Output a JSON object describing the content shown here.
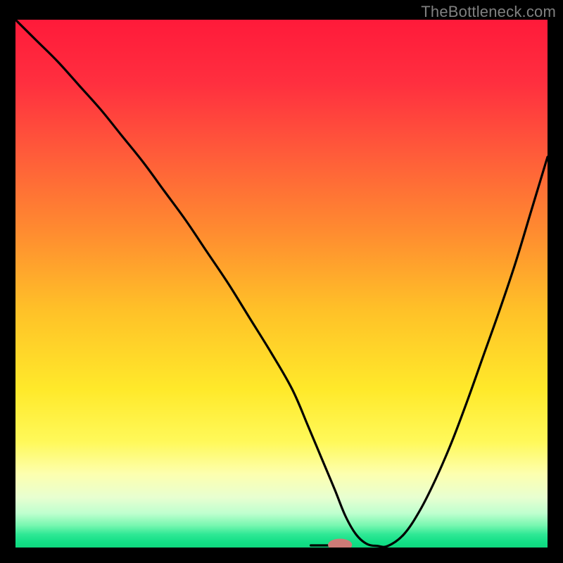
{
  "watermark": "TheBottleneck.com",
  "colors": {
    "frame": "#000000",
    "gradient_stops": [
      {
        "offset": 0.0,
        "color": "#ff1a3a"
      },
      {
        "offset": 0.12,
        "color": "#ff2f3f"
      },
      {
        "offset": 0.25,
        "color": "#ff5a3a"
      },
      {
        "offset": 0.4,
        "color": "#ff8b30"
      },
      {
        "offset": 0.55,
        "color": "#ffc128"
      },
      {
        "offset": 0.7,
        "color": "#ffe92a"
      },
      {
        "offset": 0.8,
        "color": "#fff95a"
      },
      {
        "offset": 0.86,
        "color": "#fdffae"
      },
      {
        "offset": 0.905,
        "color": "#e8ffd0"
      },
      {
        "offset": 0.935,
        "color": "#bfffcf"
      },
      {
        "offset": 0.958,
        "color": "#78f7b0"
      },
      {
        "offset": 0.975,
        "color": "#2fe895"
      },
      {
        "offset": 0.99,
        "color": "#12df86"
      },
      {
        "offset": 1.0,
        "color": "#0fd87f"
      }
    ],
    "curve": "#000000",
    "marker_fill": "#cd7b77",
    "marker_stroke": "#cd7b77"
  },
  "chart_data": {
    "type": "line",
    "title": "",
    "xlabel": "",
    "ylabel": "",
    "xlim": [
      0,
      100
    ],
    "ylim": [
      0,
      100
    ],
    "grid": false,
    "legend": false,
    "series": [
      {
        "name": "bottleneck-curve",
        "x": [
          0,
          4,
          8,
          12,
          16,
          20,
          24,
          28,
          32,
          36,
          40,
          44,
          48,
          52,
          55,
          57.5,
          60,
          62,
          64,
          66,
          68,
          70,
          73,
          76,
          79,
          82,
          85,
          88,
          91,
          94,
          97,
          100
        ],
        "y": [
          100,
          96,
          92,
          87.5,
          83,
          78,
          73,
          67.5,
          62,
          56,
          50,
          43.5,
          37,
          30,
          23,
          17,
          11,
          6,
          2.5,
          0.7,
          0.3,
          0.3,
          2.5,
          7,
          13,
          20,
          28,
          36.5,
          45,
          54,
          64,
          74
        ]
      },
      {
        "name": "flat-segment",
        "x": [
          55.5,
          60.5
        ],
        "y": [
          0.4,
          0.4
        ]
      }
    ],
    "marker": {
      "x": 61,
      "y": 0.5,
      "rx": 2.2,
      "ry": 1.1
    }
  }
}
